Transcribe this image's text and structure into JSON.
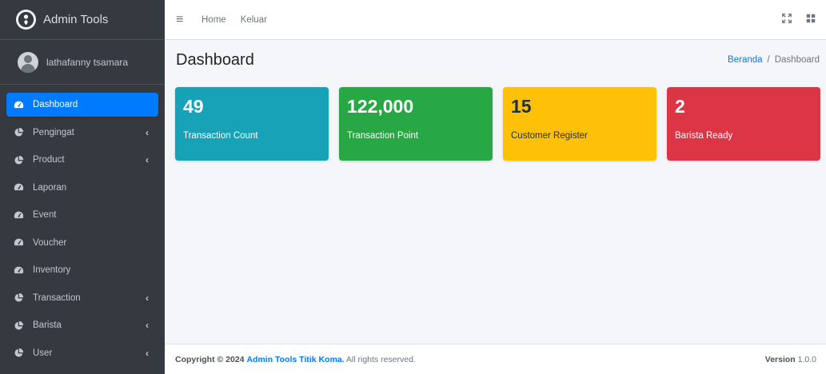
{
  "brand": {
    "title": "Admin Tools"
  },
  "user": {
    "name": "lathafanny tsamara"
  },
  "sidebar": {
    "items": [
      {
        "label": "Dashboard",
        "icon": "tachometer-icon",
        "active": true
      },
      {
        "label": "Pengingat",
        "icon": "chart-pie-icon",
        "has_children": true
      },
      {
        "label": "Product",
        "icon": "chart-pie-icon",
        "has_children": true
      },
      {
        "label": "Laporan",
        "icon": "tachometer-icon"
      },
      {
        "label": "Event",
        "icon": "tachometer-icon"
      },
      {
        "label": "Voucher",
        "icon": "tachometer-icon"
      },
      {
        "label": "Inventory",
        "icon": "tachometer-icon"
      },
      {
        "label": "Transaction",
        "icon": "chart-pie-icon",
        "has_children": true
      },
      {
        "label": "Barista",
        "icon": "chart-pie-icon",
        "has_children": true
      },
      {
        "label": "User",
        "icon": "chart-pie-icon",
        "has_children": true
      }
    ],
    "chevron": "‹"
  },
  "topnav": {
    "home": "Home",
    "logout": "Keluar"
  },
  "page": {
    "title": "Dashboard",
    "breadcrumb": {
      "home": "Beranda",
      "separator": "/",
      "current": "Dashboard"
    }
  },
  "stats": [
    {
      "value": "49",
      "label": "Transaction Count",
      "color": "#17a2b8"
    },
    {
      "value": "122,000",
      "label": "Transaction Point",
      "color": "#28a745"
    },
    {
      "value": "15",
      "label": "Customer Register",
      "color": "#ffc107"
    },
    {
      "value": "2",
      "label": "Barista Ready",
      "color": "#dc3545"
    }
  ],
  "footer": {
    "copyright_prefix": "Copyright © 2024",
    "brand": "Admin Tools Titik Koma.",
    "suffix": "All rights reserved.",
    "version_label": "Version",
    "version": "1.0.0"
  }
}
